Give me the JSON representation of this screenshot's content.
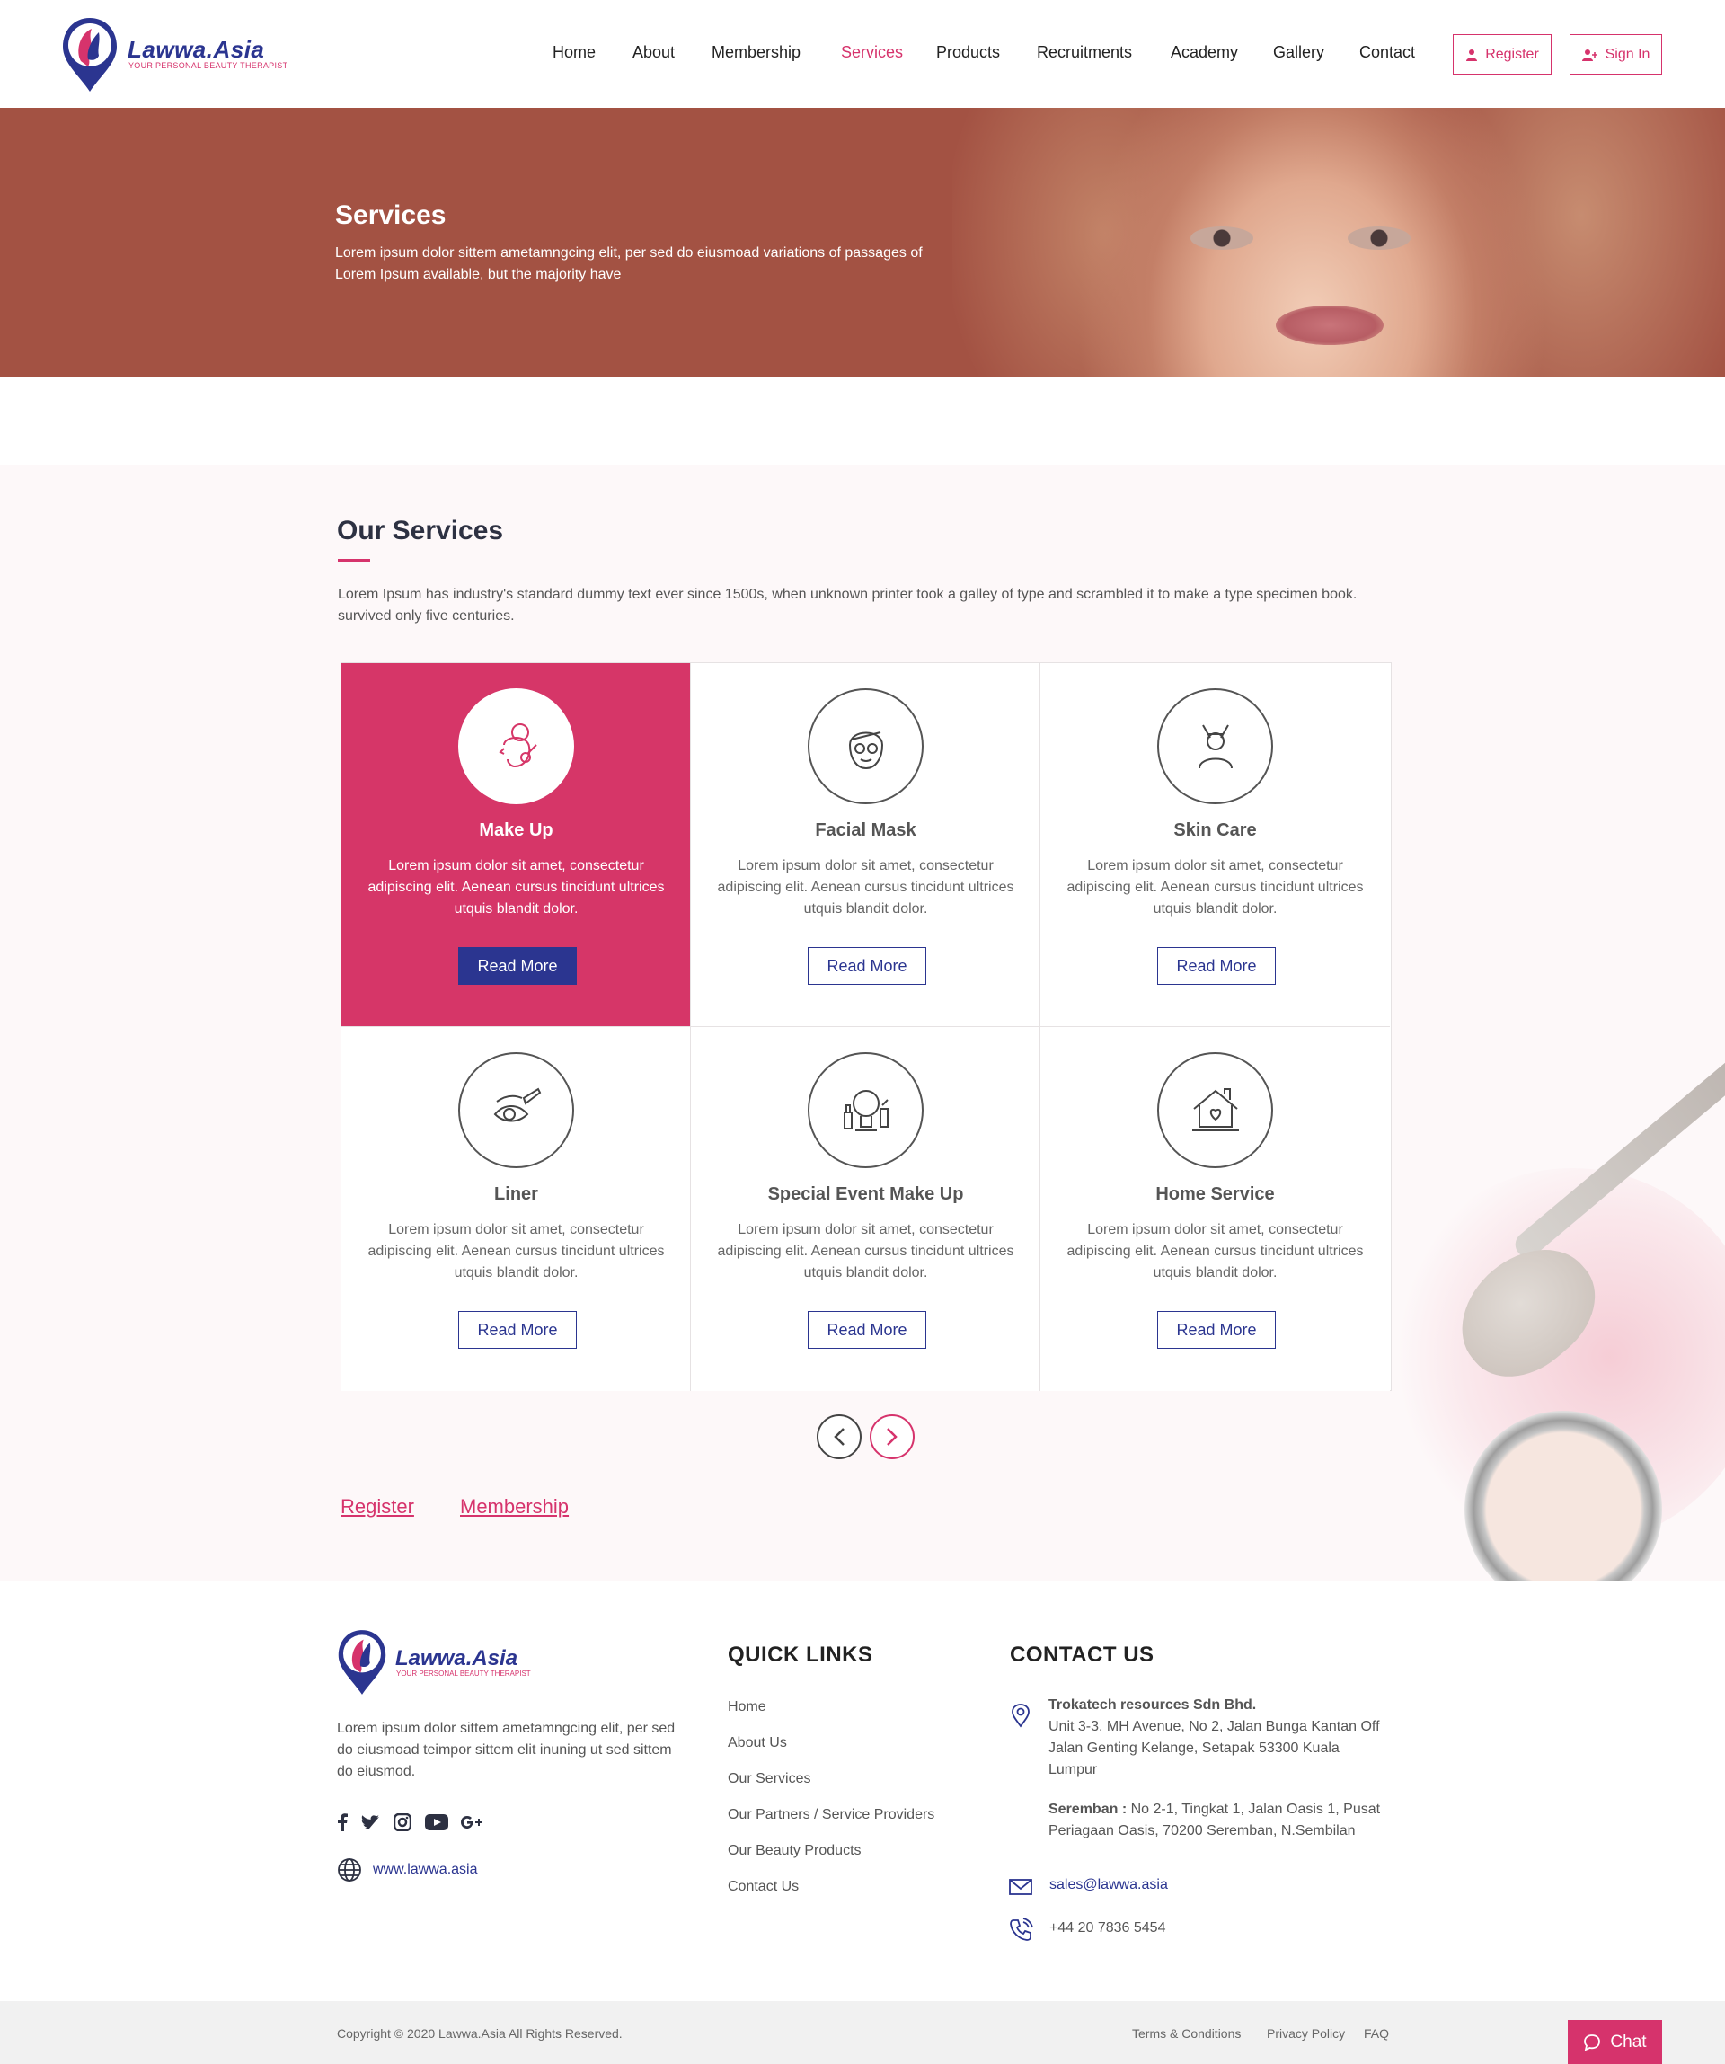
{
  "brand": {
    "name": "Lawwa.Asia",
    "tagline": "YOUR PERSONAL BEAUTY THERAPIST",
    "primary_color": "#2b3590",
    "accent_color": "#d6336c"
  },
  "nav": {
    "items": [
      {
        "label": "Home"
      },
      {
        "label": "About"
      },
      {
        "label": "Membership"
      },
      {
        "label": "Services",
        "active": true
      },
      {
        "label": "Products"
      },
      {
        "label": "Recruitments"
      },
      {
        "label": "Academy"
      },
      {
        "label": "Gallery"
      },
      {
        "label": "Contact"
      }
    ],
    "register_label": "Register",
    "signin_label": "Sign In"
  },
  "hero": {
    "title": "Services",
    "subtitle": "Lorem ipsum dolor sittem ametamngcing elit, per sed do eiusmoad variations of passages of Lorem Ipsum available, but the majority have"
  },
  "services": {
    "title": "Our Services",
    "description": "Lorem Ipsum has industry's standard dummy text ever since 1500s, when unknown printer took a galley of type and scrambled it to make a type specimen book. survived only five centuries.",
    "read_more": "Read More",
    "cards": [
      {
        "title": "Make Up",
        "icon": "makeup-face-icon",
        "text": "Lorem ipsum dolor sit amet, consectetur adipiscing elit. Aenean cursus tincidunt ultrices utquis blandit dolor.",
        "active": true
      },
      {
        "title": "Facial Mask",
        "icon": "facial-mask-icon",
        "text": "Lorem ipsum dolor sit amet, consectetur adipiscing elit. Aenean cursus tincidunt ultrices utquis blandit dolor."
      },
      {
        "title": "Skin Care",
        "icon": "skin-care-icon",
        "text": "Lorem ipsum dolor sit amet, consectetur adipiscing elit. Aenean cursus tincidunt ultrices utquis blandit dolor."
      },
      {
        "title": "Liner",
        "icon": "eyeliner-icon",
        "text": "Lorem ipsum dolor sit amet, consectetur adipiscing elit. Aenean cursus tincidunt ultrices utquis blandit dolor."
      },
      {
        "title": "Special Event Make Up",
        "icon": "special-event-makeup-icon",
        "text": "Lorem ipsum dolor sit amet, consectetur adipiscing elit. Aenean cursus tincidunt ultrices utquis blandit dolor."
      },
      {
        "title": "Home Service",
        "icon": "home-service-icon",
        "text": "Lorem ipsum dolor sit amet, consectetur adipiscing elit. Aenean cursus tincidunt ultrices utquis blandit dolor."
      }
    ],
    "links": {
      "register": "Register",
      "membership": "Membership"
    }
  },
  "footer": {
    "about": "Lorem ipsum dolor sittem ametamngcing elit, per sed do eiusmoad teimpor sittem elit inuning ut sed sittem do eiusmod.",
    "website": "www.lawwa.asia",
    "quick_links_title": "QUICK LINKS",
    "quick_links": [
      "Home",
      "About Us",
      "Our Services",
      "Our Partners / Service Providers",
      "Our Beauty Products",
      "Contact Us"
    ],
    "contact_title": "CONTACT US",
    "company": "Trokatech resources Sdn Bhd.",
    "address": "Unit 3-3, MH Avenue, No 2, Jalan Bunga Kantan Off Jalan Genting Kelange, Setapak 53300 Kuala Lumpur",
    "branch_label": "Seremban :",
    "branch_address": "No 2-1, Tingkat 1, Jalan Oasis 1, Pusat Periagaan Oasis, 70200 Seremban, N.Sembilan",
    "email": "sales@lawwa.asia",
    "phone": "+44 20 7836 5454"
  },
  "bottom_bar": {
    "copyright": "Copyright © 2020 Lawwa.Asia All Rights Reserved.",
    "terms": "Terms & Conditions",
    "privacy": "Privacy Policy",
    "faq": "FAQ",
    "chat_label": "Chat"
  }
}
